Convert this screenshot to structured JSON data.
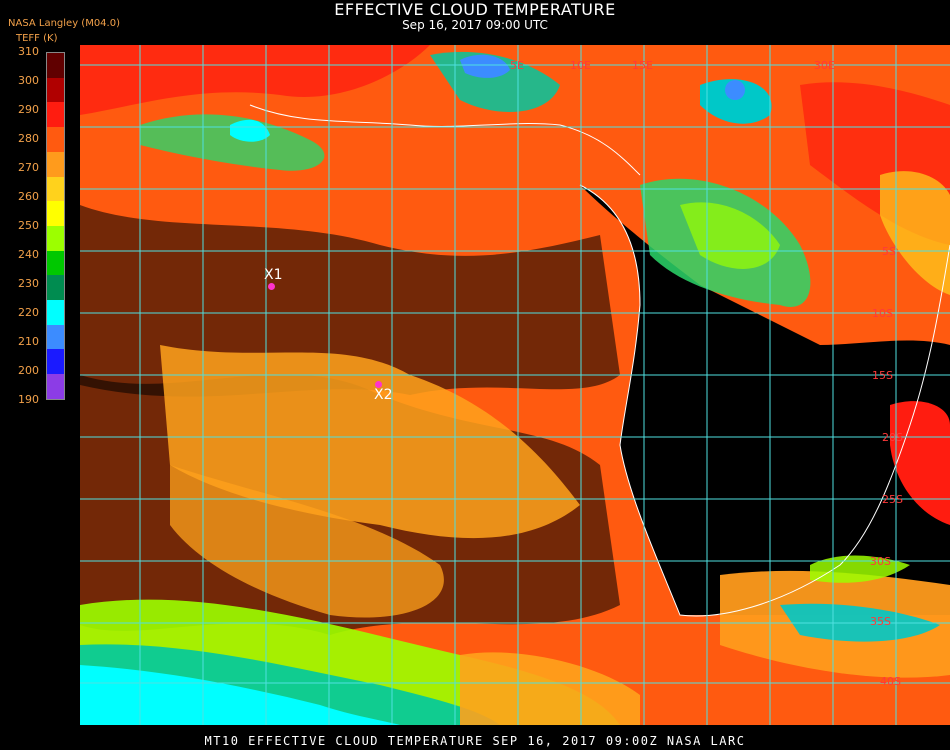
{
  "header": {
    "title": "EFFECTIVE CLOUD TEMPERATURE",
    "datetime": "Sep 16, 2017 09:00 UTC",
    "product": "NASA Langley (M04.0)"
  },
  "colorbar": {
    "unit_label": "TEFF (K)",
    "ticks": [
      "310",
      "300",
      "290",
      "280",
      "270",
      "260",
      "250",
      "240",
      "230",
      "220",
      "210",
      "200",
      "190"
    ],
    "colors": [
      "#600000",
      "#b00000",
      "#ff1c10",
      "#ff5a10",
      "#ff9b1c",
      "#ffd21c",
      "#ffff00",
      "#9cff00",
      "#00c800",
      "#008c50",
      "#00ffff",
      "#3c8cff",
      "#1a1aff",
      "#8c3ce6"
    ]
  },
  "grid_labels": [
    "15E",
    "30E",
    "15S",
    "5S",
    "10S",
    "15S",
    "20S",
    "25S",
    "30S",
    "35S",
    "40S",
    "5E",
    "10E"
  ],
  "markers": [
    {
      "label": "X1"
    },
    {
      "label": "X2"
    }
  ],
  "footer": "MT10  EFFECTIVE CLOUD TEMPERATURE   SEP 16, 2017 09:00Z   NASA LARC"
}
